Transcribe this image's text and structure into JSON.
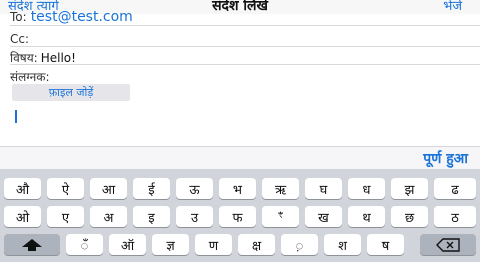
{
  "nav": {
    "cancel": "संदेश त्यागें",
    "title": "संदेश लिखें",
    "send": "भेजें"
  },
  "compose": {
    "to_label": "To:",
    "to_value": "test@test.com",
    "cc_label": "Cc:",
    "subject_label": "विषय:",
    "subject_value": "Hello!",
    "attach_label": "संलग्नक:",
    "attach_button": "फ़ाइल जोड़ें"
  },
  "toolbar": {
    "done": "पूर्ण हुआ"
  },
  "keyboard": {
    "row1": [
      "औ",
      "ऐ",
      "आ",
      "ई",
      "ऊ",
      "भ",
      "ऋ",
      "घ",
      "ध",
      "झ",
      "ढ"
    ],
    "row2": [
      "ओ",
      "ए",
      "अ",
      "इ",
      "उ",
      "फ",
      "ꣳ",
      "ख",
      "थ",
      "छ",
      "ठ"
    ],
    "row3_letters": [
      "ँ",
      "ऑ",
      "ज्ञ",
      "ण",
      "क्ष",
      "़",
      "श",
      "ष"
    ],
    "shift_icon": "shift-icon",
    "delete_icon": "delete-icon"
  }
}
